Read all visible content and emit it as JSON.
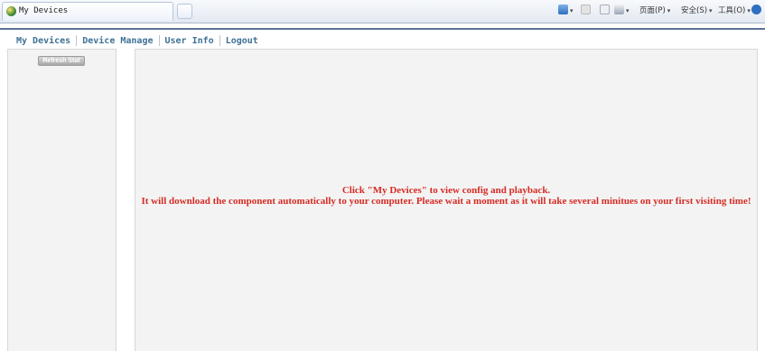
{
  "browser": {
    "tab_title": "My Devices",
    "commands": {
      "page": "页面(P)",
      "safety": "安全(S)",
      "tools": "工具(O)"
    }
  },
  "nav": {
    "items": [
      {
        "label": "My Devices"
      },
      {
        "label": "Device Manage"
      },
      {
        "label": "User Info"
      },
      {
        "label": "Logout"
      }
    ]
  },
  "sidebar": {
    "refresh_button": "Refresh Stat"
  },
  "main": {
    "message_line1": "Click \"My Devices\" to view config and playback.",
    "message_line2": "It will download the component automatically to your computer. Please wait a moment as it will take several minitues on your first visiting time!"
  }
}
